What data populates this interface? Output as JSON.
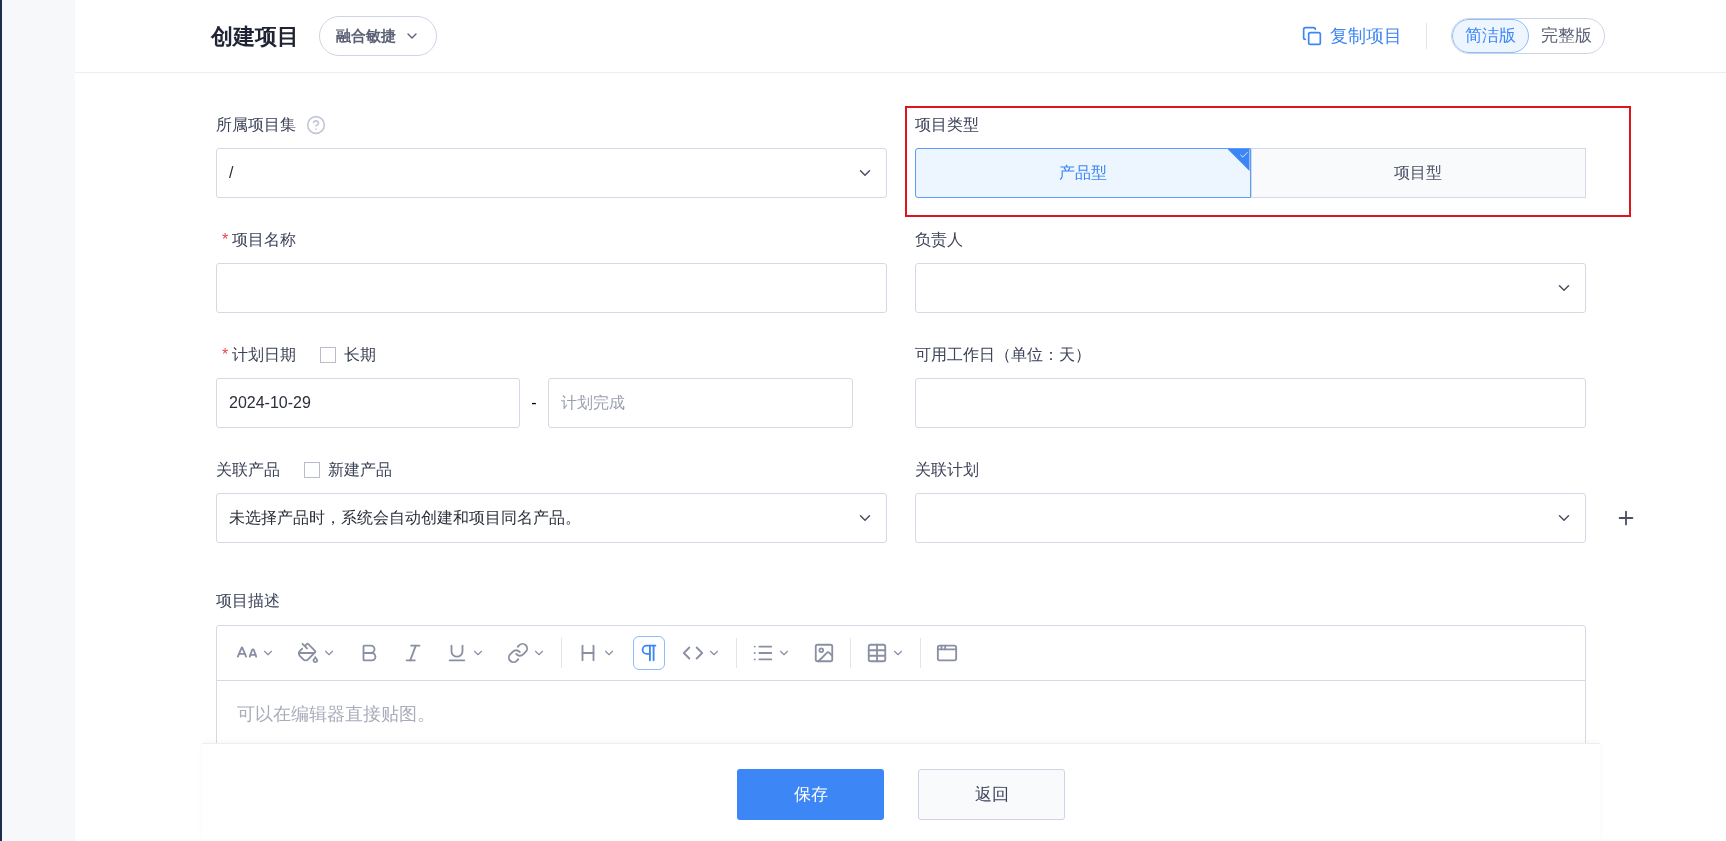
{
  "header": {
    "title": "创建项目",
    "mode_select": "融合敏捷",
    "copy_link": "复制项目",
    "view_toggle": [
      {
        "label": "简洁版",
        "selected": true
      },
      {
        "label": "完整版",
        "selected": false
      }
    ]
  },
  "rows": [
    [
      {
        "kind": "select",
        "label": "所属项目集",
        "help": true,
        "value": "/"
      },
      {
        "kind": "choice",
        "label": "项目类型",
        "highlighted": true,
        "options": [
          {
            "label": "产品型",
            "selected": true
          },
          {
            "label": "项目型",
            "selected": false
          }
        ]
      }
    ],
    [
      {
        "kind": "text",
        "label": "项目名称",
        "required_mark": "*"
      },
      {
        "kind": "select",
        "label": "负责人"
      }
    ],
    [
      {
        "kind": "date_range",
        "label": "计划日期",
        "required_mark": "*",
        "checkbox": {
          "label": "长期",
          "checked": false
        },
        "start": "2024-10-29",
        "separator": "-",
        "end_placeholder": "计划完成"
      },
      {
        "kind": "text",
        "label": "可用工作日（单位：天）"
      }
    ],
    [
      {
        "kind": "select",
        "label": "关联产品",
        "checkbox": {
          "label": "新建产品",
          "checked": false
        },
        "value": "未选择产品时，系统会自动创建和项目同名产品。"
      },
      {
        "kind": "select",
        "label": "关联计划",
        "add": true
      }
    ]
  ],
  "description": {
    "label": "项目描述",
    "toolbar": [
      [
        {
          "selected": false,
          "dropdown": true
        },
        {
          "selected": false,
          "dropdown": true
        },
        {
          "selected": false,
          "dropdown": false
        },
        {
          "selected": false,
          "dropdown": false
        },
        {
          "selected": false,
          "dropdown": true
        },
        {
          "selected": false,
          "dropdown": true
        }
      ],
      [
        {
          "selected": false,
          "dropdown": true
        },
        {
          "selected": true,
          "dropdown": false
        },
        {
          "selected": false,
          "dropdown": true
        }
      ],
      [
        {
          "selected": false,
          "dropdown": true
        },
        {
          "selected": false,
          "dropdown": false
        }
      ],
      [
        {
          "selected": false,
          "dropdown": true
        }
      ],
      [
        {
          "selected": false,
          "dropdown": false
        }
      ]
    ],
    "placeholder": "可以在编辑器直接贴图。"
  },
  "footer": [
    {
      "label": "保存",
      "kind": "primary"
    },
    {
      "label": "返回",
      "kind": "secondary"
    }
  ]
}
